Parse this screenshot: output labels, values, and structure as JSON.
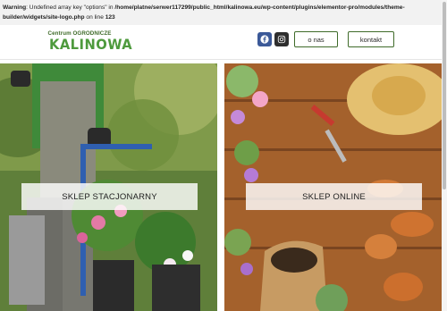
{
  "warning": {
    "prefix": "Warning",
    "message": ": Undefined array key \"options\" in ",
    "path": "/home/platne/serwer117299/public_html/kalinowa.eu/wp-content/plugins/elementor-pro/modules/theme-builder/widgets/site-logo.php",
    "line_text": " on line ",
    "line_number": "123"
  },
  "header": {
    "logo": {
      "top_text": "Centrum OGRODNICZE",
      "main_text": "KALINOWA"
    },
    "social": [
      {
        "icon": "facebook-icon",
        "color": "#3b5998"
      },
      {
        "icon": "instagram-icon",
        "color": "#2e2e2e"
      }
    ],
    "nav": {
      "about_label": "o nas",
      "contact_label": "kontakt"
    }
  },
  "panels": {
    "left": {
      "label": "SKLEP STACJONARNY"
    },
    "right": {
      "label": "SKLEP ONLINE"
    }
  },
  "colors": {
    "brand_green": "#4e9a3d",
    "dark_green": "#3f6b2a"
  }
}
